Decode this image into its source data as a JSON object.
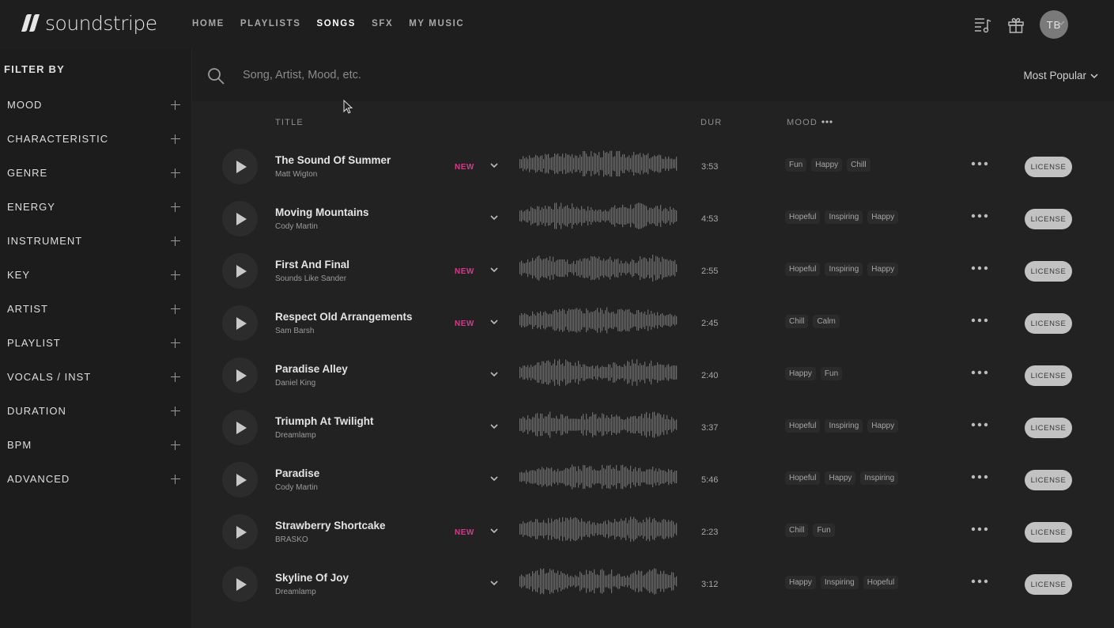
{
  "app": {
    "logo_text": "soundstripe"
  },
  "nav": [
    {
      "label": "HOME",
      "active": false
    },
    {
      "label": "PLAYLISTS",
      "active": false
    },
    {
      "label": "SONGS",
      "active": true
    },
    {
      "label": "SFX",
      "active": false
    },
    {
      "label": "MY MUSIC",
      "active": false
    }
  ],
  "header": {
    "icons": [
      "queue-music-icon",
      "gift-icon"
    ],
    "avatar_initials": "TB"
  },
  "sidebar": {
    "title": "FILTER BY",
    "filters": [
      "MOOD",
      "CHARACTERISTIC",
      "GENRE",
      "ENERGY",
      "INSTRUMENT",
      "KEY",
      "ARTIST",
      "PLAYLIST",
      "VOCALS / INST",
      "DURATION",
      "BPM",
      "ADVANCED"
    ]
  },
  "search": {
    "placeholder": "Song, Artist, Mood, etc.",
    "value": "",
    "sort_label": "Most Popular"
  },
  "columns": {
    "title": "TITLE",
    "duration": "DUR",
    "mood": "MOOD"
  },
  "songs": [
    {
      "title": "The Sound Of Summer",
      "artist": "Matt Wigton",
      "badge": "NEW",
      "duration": "3:53",
      "moods": [
        "Fun",
        "Happy",
        "Chill"
      ],
      "action": "LICENSE"
    },
    {
      "title": "Moving Mountains",
      "artist": "Cody Martin",
      "badge": "",
      "duration": "4:53",
      "moods": [
        "Hopeful",
        "Inspiring",
        "Happy"
      ],
      "action": "LICENSE"
    },
    {
      "title": "First And Final",
      "artist": "Sounds Like Sander",
      "badge": "NEW",
      "duration": "2:55",
      "moods": [
        "Hopeful",
        "Inspiring",
        "Happy"
      ],
      "action": "LICENSE"
    },
    {
      "title": "Respect Old Arrangements",
      "artist": "Sam Barsh",
      "badge": "NEW",
      "duration": "2:45",
      "moods": [
        "Chill",
        "Calm"
      ],
      "action": "LICENSE"
    },
    {
      "title": "Paradise Alley",
      "artist": "Daniel King",
      "badge": "",
      "duration": "2:40",
      "moods": [
        "Happy",
        "Fun"
      ],
      "action": "LICENSE"
    },
    {
      "title": "Triumph At Twilight",
      "artist": "Dreamlamp",
      "badge": "",
      "duration": "3:37",
      "moods": [
        "Hopeful",
        "Inspiring",
        "Happy"
      ],
      "action": "LICENSE"
    },
    {
      "title": "Paradise",
      "artist": "Cody Martin",
      "badge": "",
      "duration": "5:46",
      "moods": [
        "Hopeful",
        "Happy",
        "Inspiring"
      ],
      "action": "LICENSE"
    },
    {
      "title": "Strawberry Shortcake",
      "artist": "BRASKO",
      "badge": "NEW",
      "duration": "2:23",
      "moods": [
        "Chill",
        "Fun"
      ],
      "action": "LICENSE"
    },
    {
      "title": "Skyline Of Joy",
      "artist": "Dreamlamp",
      "badge": "",
      "duration": "3:12",
      "moods": [
        "Happy",
        "Inspiring",
        "Hopeful"
      ],
      "action": "LICENSE"
    }
  ],
  "colors": {
    "new_badge": "#d6398c",
    "license_button": "#c2c2c2",
    "background": "#222222"
  }
}
